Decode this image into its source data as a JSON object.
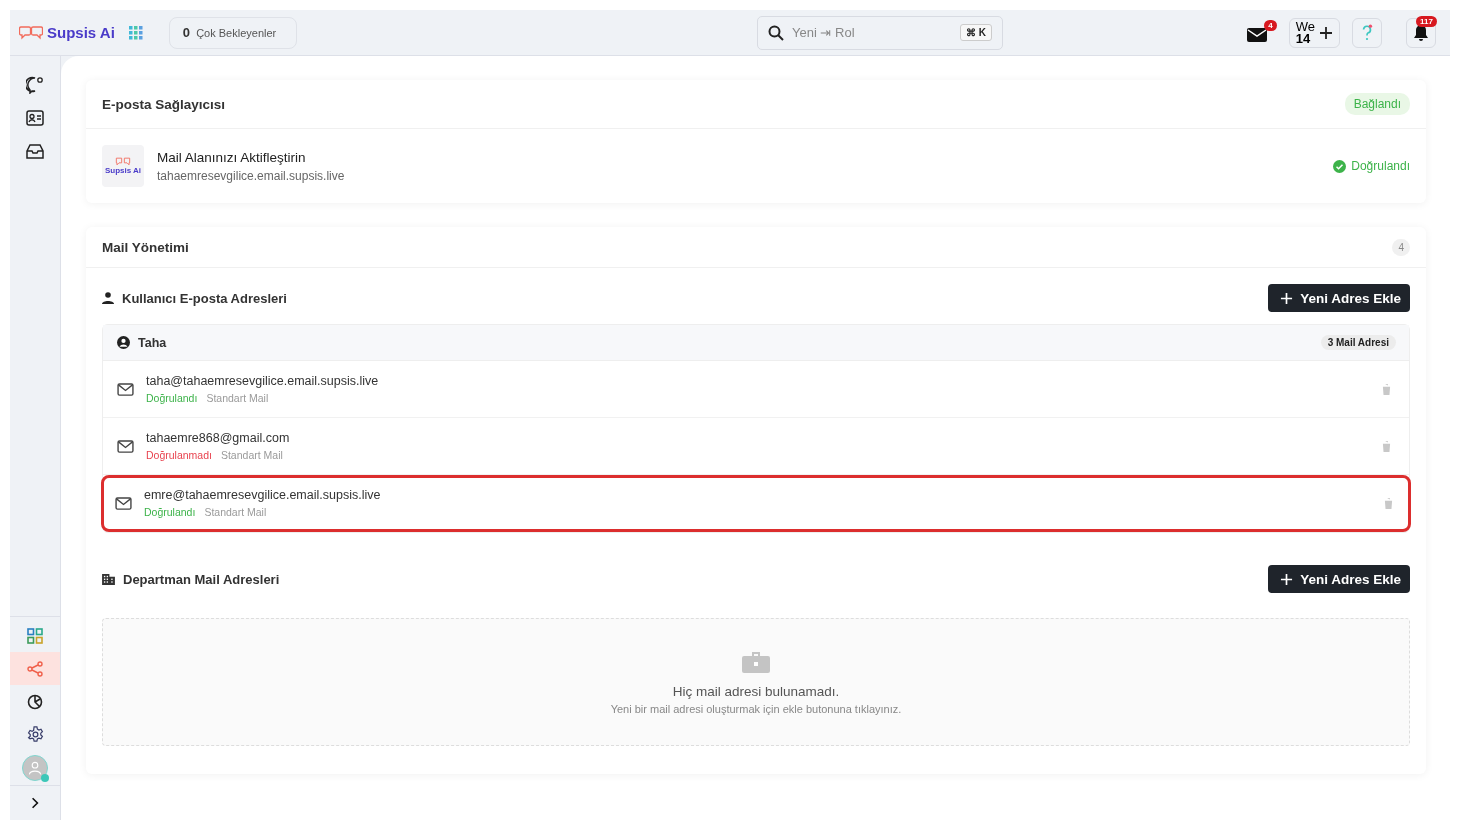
{
  "topbar": {
    "brand": "Supsis Ai",
    "waiting": {
      "count": "0",
      "label": "Çok Bekleyenler"
    },
    "search": {
      "value": "Yeni ⇥ Rol",
      "shortcut": "⌘ K"
    },
    "mail_badge": "4",
    "workspace": {
      "name": "We",
      "number": "14"
    },
    "notification_badge": "117"
  },
  "sidebar": {
    "top_items": [
      {
        "kind": "chat",
        "selected": false
      },
      {
        "kind": "contact",
        "selected": false
      },
      {
        "kind": "inbox",
        "selected": false
      }
    ],
    "bottom_items": [
      {
        "kind": "apps",
        "selected": false
      },
      {
        "kind": "share",
        "selected": true
      },
      {
        "kind": "pie",
        "selected": false
      },
      {
        "kind": "gear",
        "selected": false
      }
    ]
  },
  "provider": {
    "title": "E-posta Sağlayıcısı",
    "status": "Bağlandı",
    "logo_text": "Supsis Ai",
    "domain_title": "Mail Alanınızı Aktifleştirin",
    "domain": "tahaemresevgilice.email.supsis.live",
    "verified_label": "Doğrulandı"
  },
  "management": {
    "title": "Mail Yönetimi",
    "count": "4",
    "user_section": {
      "title": "Kullanıcı E-posta Adresleri",
      "button": "Yeni Adres Ekle",
      "groups": [
        {
          "name": "Taha",
          "badge": "3 Mail Adresi",
          "addresses": [
            {
              "email": "taha@tahaemresevgilice.email.supsis.live",
              "status": "Doğrulandı",
              "verified": true,
              "type": "Standart Mail",
              "highlighted": false
            },
            {
              "email": "tahaemre868@gmail.com",
              "status": "Doğrulanmadı",
              "verified": false,
              "type": "Standart Mail",
              "highlighted": false
            },
            {
              "email": "emre@tahaemresevgilice.email.supsis.live",
              "status": "Doğrulandı",
              "verified": true,
              "type": "Standart Mail",
              "highlighted": true
            }
          ]
        }
      ]
    },
    "department_section": {
      "title": "Departman Mail Adresleri",
      "button": "Yeni Adres Ekle",
      "empty_title": "Hiç mail adresi bulunamadı.",
      "empty_text": "Yeni bir mail adresi oluşturmak için ekle butonuna tıklayınız."
    }
  }
}
